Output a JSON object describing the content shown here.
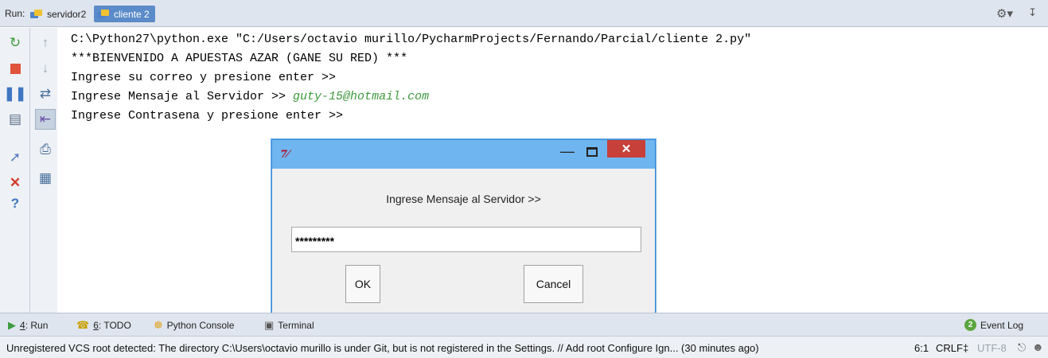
{
  "run_bar": {
    "label": "Run:",
    "tabs": [
      {
        "label": "servidor2",
        "active": false,
        "icon": "python-file-icon"
      },
      {
        "label": "cliente 2",
        "active": true,
        "icon": "python-file-icon"
      }
    ],
    "icons": [
      "settings-gear-icon",
      "hide-panel-icon"
    ]
  },
  "left_toolbar": {
    "primary_icons": [
      "rerun-icon",
      "stop-icon",
      "pause-icon",
      "layout-icon",
      "pin-icon",
      "close-icon",
      "help-icon"
    ],
    "secondary_icons": [
      "scroll-up-icon",
      "scroll-down-icon",
      "soft-wrap-icon",
      "scroll-to-end-icon",
      "print-icon",
      "clear-all-icon"
    ]
  },
  "console": {
    "lines": [
      {
        "text": "C:\\Python27\\python.exe \"C:/Users/octavio murillo/PycharmProjects/Fernando/Parcial/cliente 2.py\""
      },
      {
        "text": "***BIENVENIDO A APUESTAS AZAR (GANE SU RED) ***"
      },
      {
        "text": "Ingrese su correo y presione enter >>"
      },
      {
        "text": "Ingrese Mensaje al Servidor >> ",
        "input": "guty-15@hotmail.com"
      },
      {
        "text": "Ingrese Contrasena y presione enter >>"
      }
    ],
    "input_color": "#3d9a3d"
  },
  "dialog": {
    "title_icon": "7⁄",
    "controls": {
      "minimize": "—",
      "maximize": "",
      "close": "✕"
    },
    "prompt": "Ingrese Mensaje al Servidor >>",
    "entry_value": "*********",
    "ok_label": "OK",
    "cancel_label": "Cancel",
    "title_color": "#6fb6f0",
    "close_color": "#c7403a"
  },
  "tool_windows": {
    "run": {
      "num": "4",
      "label": ": Run"
    },
    "todo": {
      "num": "6",
      "label": ": TODO"
    },
    "python_console": {
      "label": "Python Console"
    },
    "terminal": {
      "label": "Terminal"
    },
    "event_log": {
      "badge": "2",
      "label": "Event Log"
    }
  },
  "status_bar": {
    "message": "Unregistered VCS root detected: The directory C:\\Users\\octavio murillo is under Git, but is not registered in the Settings. // Add root  Configure  Ign... (30 minutes ago)",
    "position": "6:1",
    "line_separator": "CRLF‡",
    "encoding": "UTF-8"
  }
}
